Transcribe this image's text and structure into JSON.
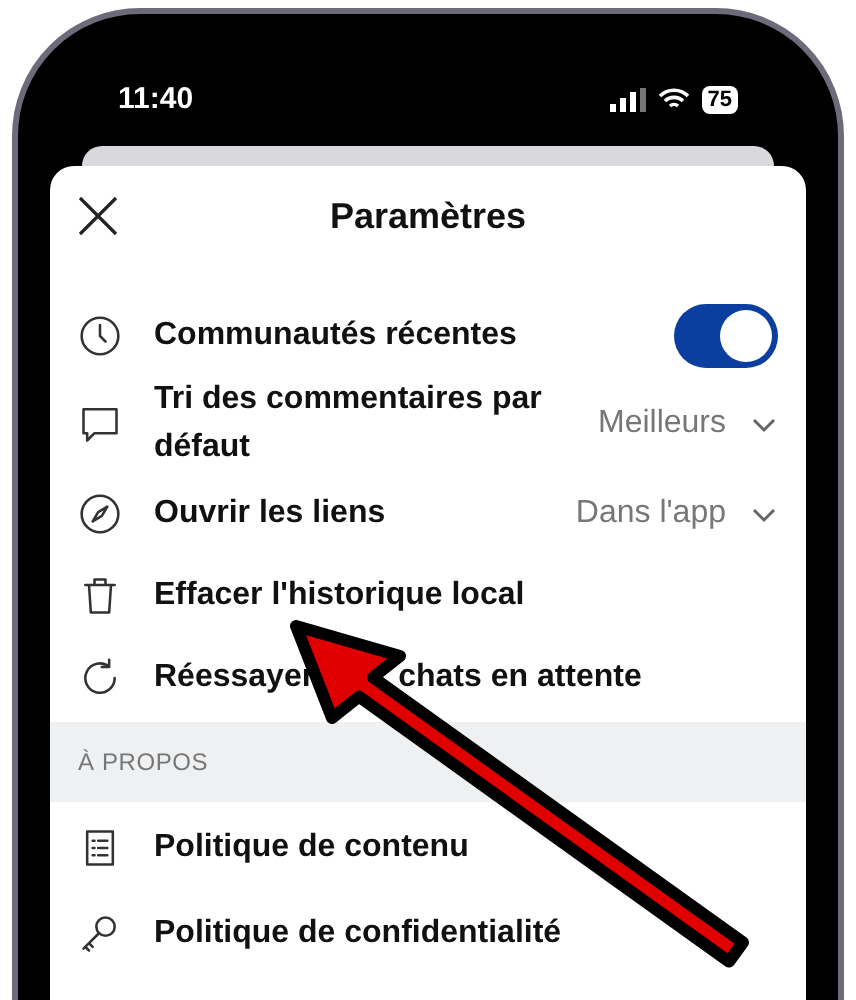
{
  "status_bar": {
    "time": "11:40",
    "battery": "75"
  },
  "header": {
    "title": "Paramètres"
  },
  "rows": [
    {
      "kind": "toggle",
      "label": "Communautés récentes",
      "on": true
    },
    {
      "kind": "select",
      "label": "Tri des commentaires par défaut",
      "value": "Meilleurs"
    },
    {
      "kind": "select",
      "label": "Ouvrir les liens",
      "value": "Dans l'app"
    },
    {
      "kind": "action",
      "label": "Effacer l'historique local"
    },
    {
      "kind": "split",
      "label": "Réessayer",
      "label_after": "chats en attente"
    }
  ],
  "section": {
    "title": "À PROPOS"
  },
  "about_rows": [
    {
      "label": "Politique de contenu"
    },
    {
      "label": "Politique de confidentialité"
    }
  ]
}
